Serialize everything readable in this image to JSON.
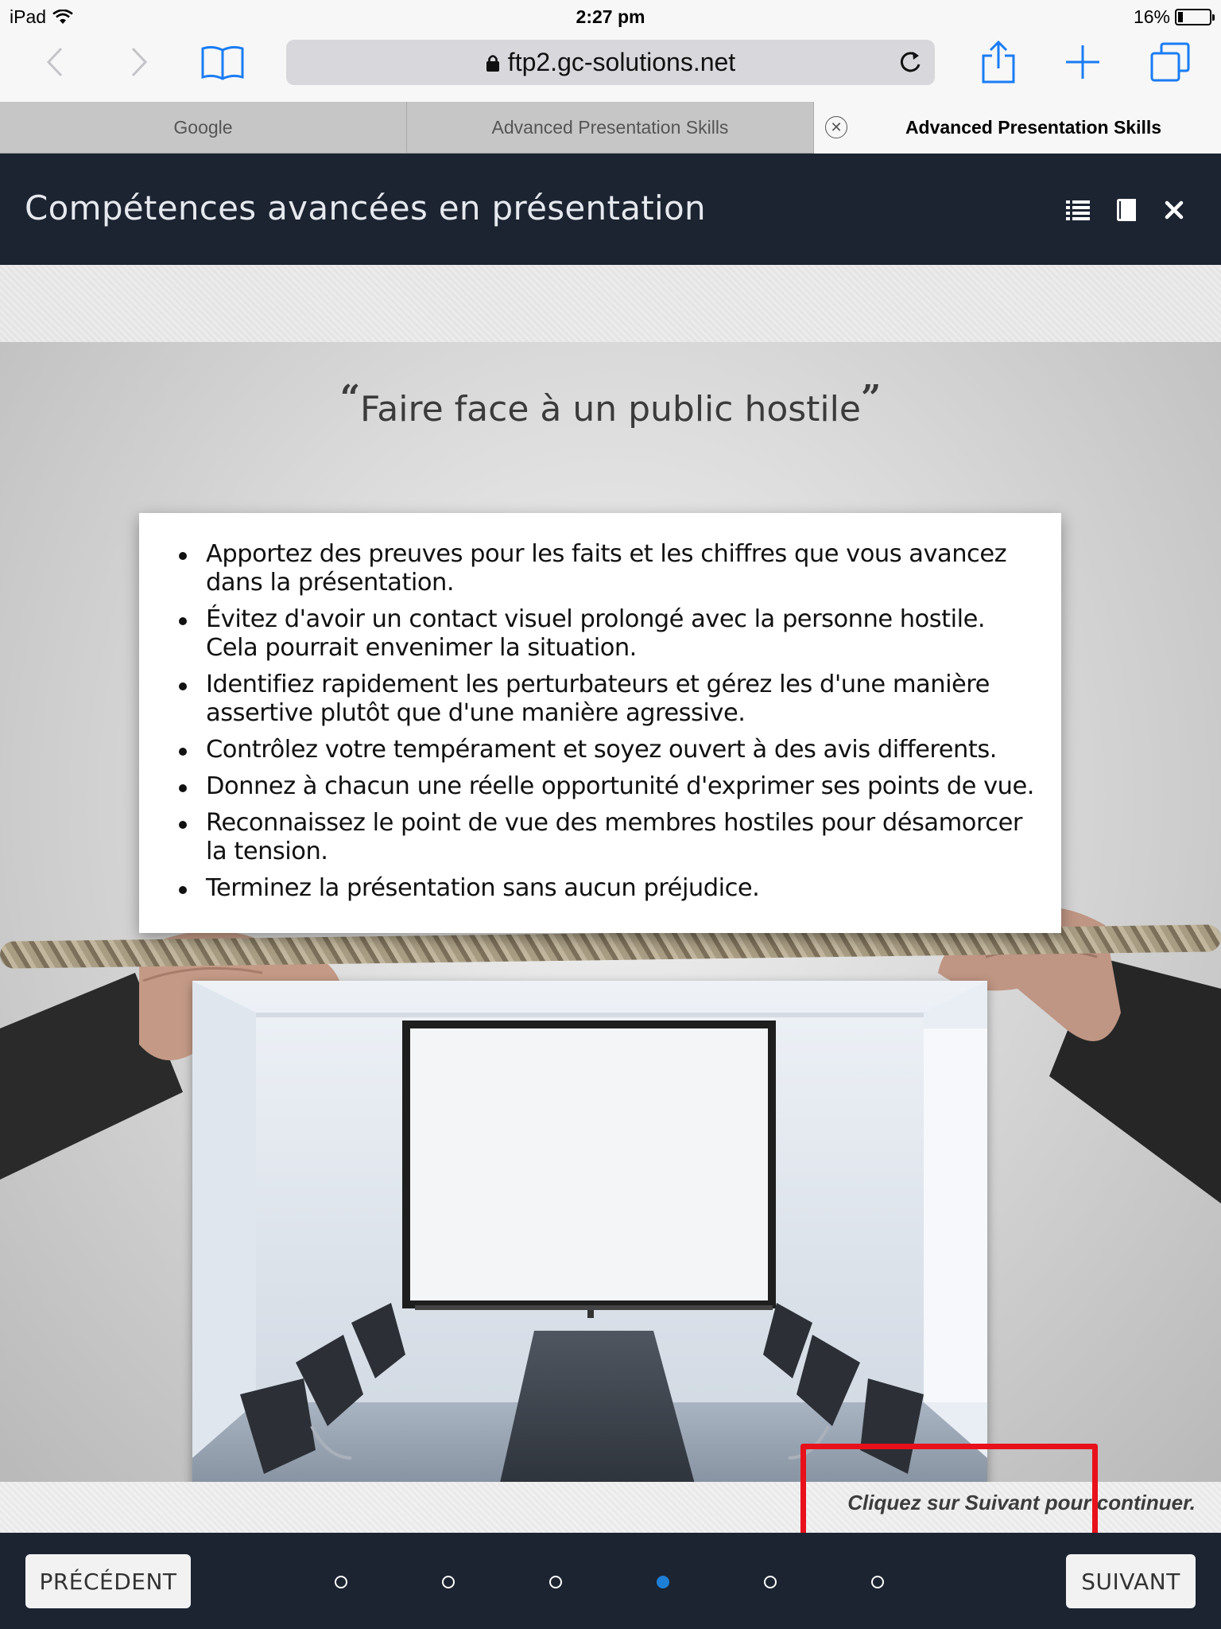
{
  "status_bar": {
    "device": "iPad",
    "time": "2:27 pm",
    "battery": "16%",
    "battery_level": 0.16
  },
  "browser": {
    "url": "ftp2.gc-solutions.net",
    "tabs": [
      {
        "label": "Google",
        "active": false
      },
      {
        "label": "Advanced Presentation Skills",
        "active": false
      },
      {
        "label": "Advanced Presentation Skills",
        "active": true
      }
    ]
  },
  "course": {
    "title": "Compétences avancées en présentation"
  },
  "slide": {
    "title": "Faire face à un public hostile",
    "open_quote": "“",
    "close_quote": "”",
    "bullets": [
      "Apportez des preuves pour les faits et les chiffres que vous avancez dans la présentation.",
      "Évitez d'avoir un contact visuel prolongé avec la personne hostile. Cela pourrait envenimer la situation.",
      "Identifiez rapidement les perturbateurs et gérez les d'une manière assertive plutôt que d'une manière agressive.",
      "Contrôlez votre tempérament et soyez ouvert à des avis differents.",
      "Donnez à chacun une réelle opportunité d'exprimer ses points de vue.",
      "Reconnaissez le point de vue des membres hostiles pour désamorcer la tension.",
      "Terminez la présentation sans aucun préjudice."
    ],
    "hint": "Cliquez sur Suivant pour continuer."
  },
  "navigation": {
    "prev_label": "PRÉCÉDENT",
    "next_label": "SUIVANT",
    "page_count": 6,
    "current_page": 4
  },
  "colors": {
    "header_bg": "#1c2432",
    "active_dot": "#1e7fd6",
    "highlight": "#e8101a",
    "ios_blue": "#1a7cf5"
  }
}
